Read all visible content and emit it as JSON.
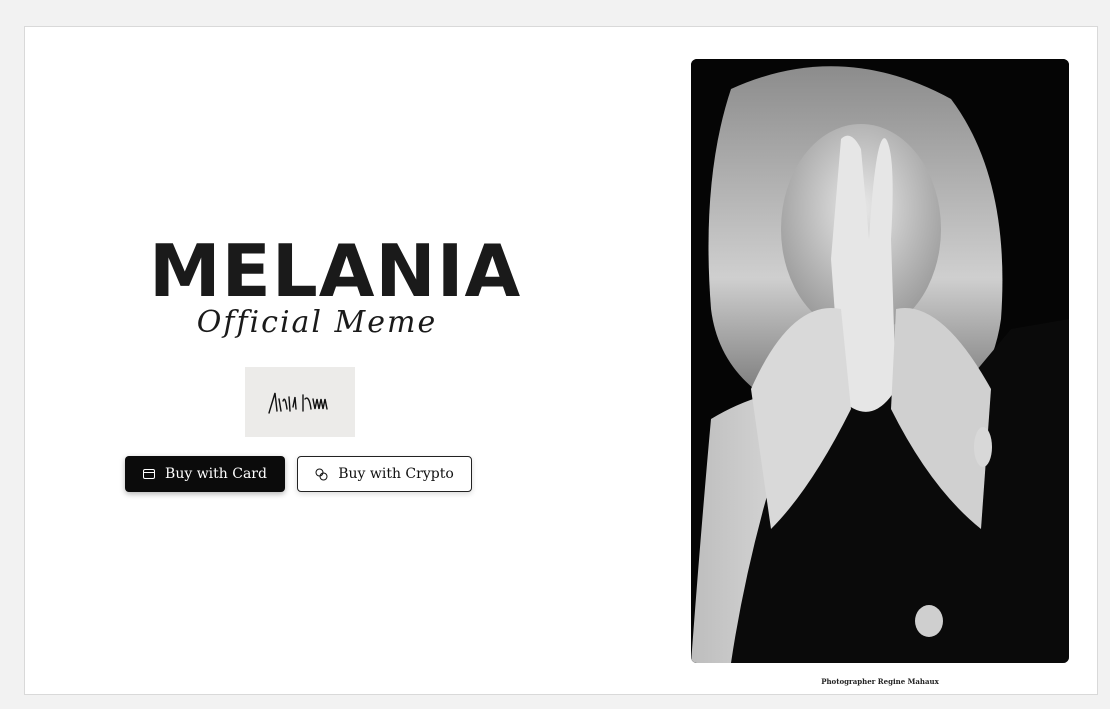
{
  "hero": {
    "brand": "MELANIA",
    "subtitle": "Official Meme"
  },
  "signature": {
    "alt": "signature"
  },
  "actions": {
    "card_label": "Buy with Card",
    "card_icon": "credit-card-icon",
    "crypto_label": "Buy with Crypto",
    "crypto_icon": "coins-icon"
  },
  "photo": {
    "caption": "Photographer Regine Mahaux"
  }
}
